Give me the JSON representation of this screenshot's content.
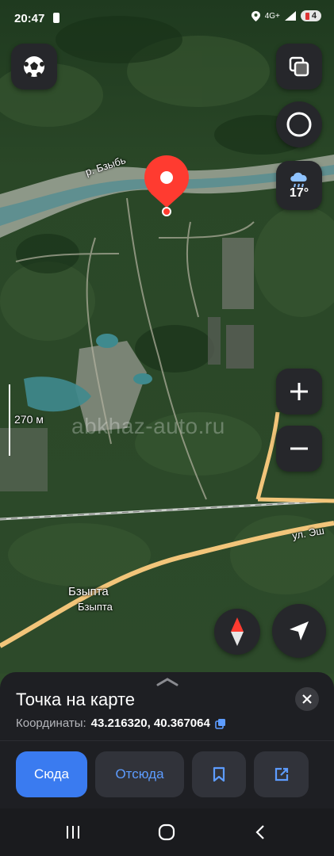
{
  "status_bar": {
    "time": "20:47",
    "network": "4G+",
    "battery": "4"
  },
  "map": {
    "river_label": "р. Бзыбь",
    "street_label": "ул. Эш",
    "village_label": "Бзыпта",
    "village_label_small": "Бзыпта",
    "scale_label": "270 м",
    "watermark": "abkhaz-auto.ru",
    "weather_temp": "17°",
    "accent_color": "#ff3b30",
    "road_color": "#f2c57a",
    "icons": {
      "profile": "soccer-ball-icon",
      "layers": "layers-icon",
      "alice": "alice-ring-icon",
      "weather": "rain-cloud-icon",
      "zoom_in": "plus-icon",
      "zoom_out": "minus-icon",
      "compass": "compass-icon",
      "locate": "navigation-arrow-icon"
    }
  },
  "sheet": {
    "title": "Точка на карте",
    "coords_label": "Координаты:",
    "coords_value": "43.216320, 40.367064",
    "actions": {
      "here": "Сюда",
      "from": "Отсюда"
    },
    "primary_color": "#3a7bf0"
  }
}
